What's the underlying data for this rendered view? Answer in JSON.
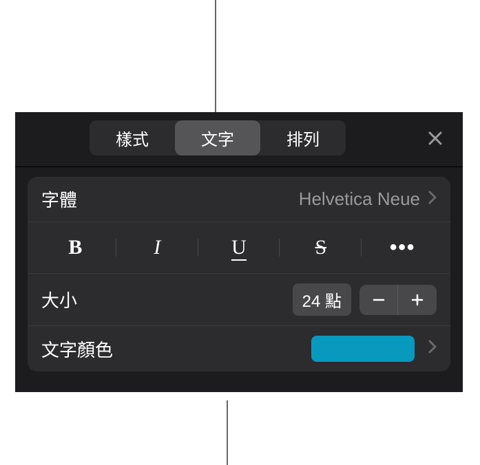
{
  "tabs": {
    "style": "樣式",
    "text": "文字",
    "arrange": "排列"
  },
  "font": {
    "label": "字體",
    "value": "Helvetica Neue"
  },
  "styleButtons": {
    "bold": "B",
    "italic": "I",
    "underline": "U",
    "strike": "S",
    "more": "•••"
  },
  "size": {
    "label": "大小",
    "value": "24 點"
  },
  "textColor": {
    "label": "文字顏色",
    "value": "#0899bf"
  }
}
